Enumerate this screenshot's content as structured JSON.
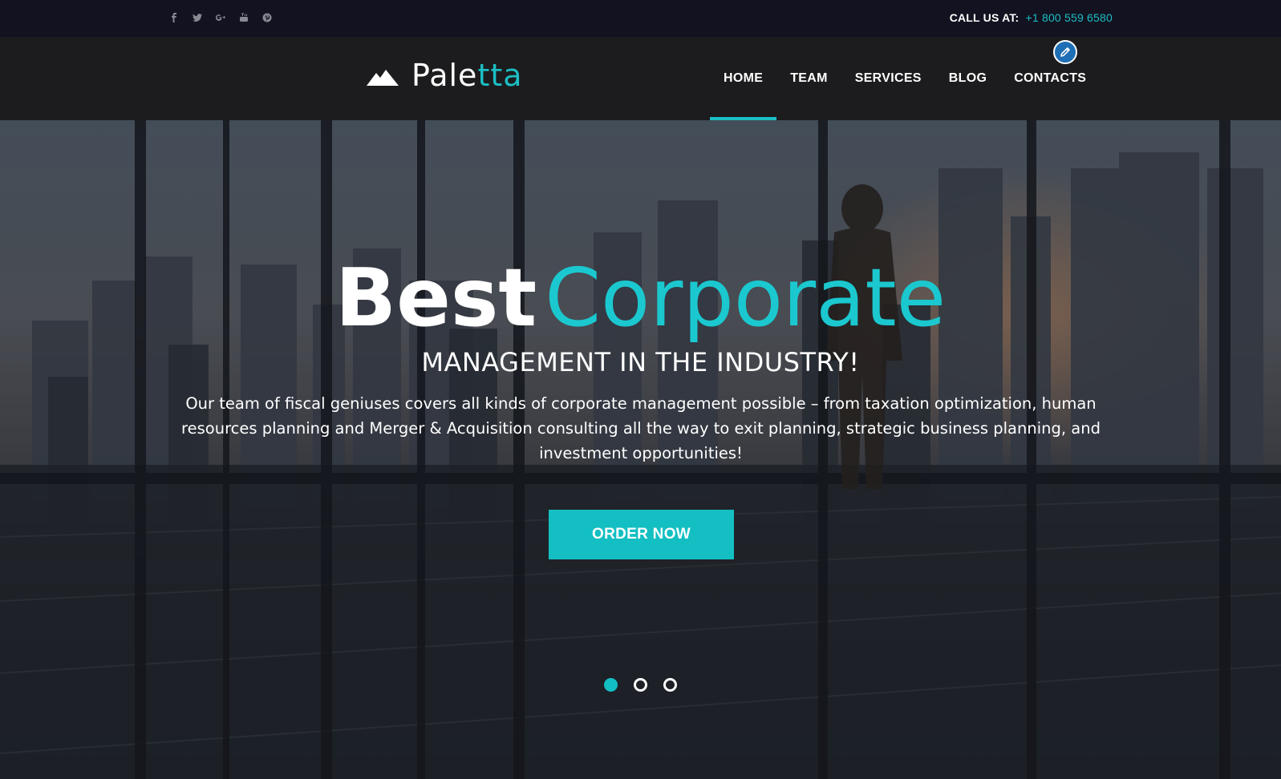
{
  "topbar": {
    "social": [
      "facebook-icon",
      "twitter-icon",
      "google-plus-icon",
      "youtube-icon",
      "pinterest-icon"
    ],
    "call_label": "CALL US AT:",
    "phone": "+1 800 559 6580"
  },
  "brand": {
    "name_main": "Pale",
    "name_accent": "tta"
  },
  "nav": {
    "items": [
      {
        "label": "HOME",
        "active": true
      },
      {
        "label": "TEAM",
        "active": false
      },
      {
        "label": "SERVICES",
        "active": false
      },
      {
        "label": "BLOG",
        "active": false
      },
      {
        "label": "CONTACTS",
        "active": false
      }
    ]
  },
  "hero": {
    "title_word1": "Best",
    "title_word2": "Corporate",
    "subtitle": "MANAGEMENT IN THE INDUSTRY!",
    "description": "Our team of fiscal geniuses covers all kinds of corporate management possible – from taxation optimization, human resources planning and Merger & Acquisition consulting all the way to exit planning, strategic business planning, and investment opportunities!",
    "cta_label": "ORDER NOW",
    "slides": [
      {
        "active": true
      },
      {
        "active": false
      },
      {
        "active": false
      }
    ]
  },
  "colors": {
    "accent": "#1bbfc4",
    "topbar_bg": "#121220",
    "navbar_bg": "#1c1c1e",
    "edit_button": "#1e6fb5"
  }
}
